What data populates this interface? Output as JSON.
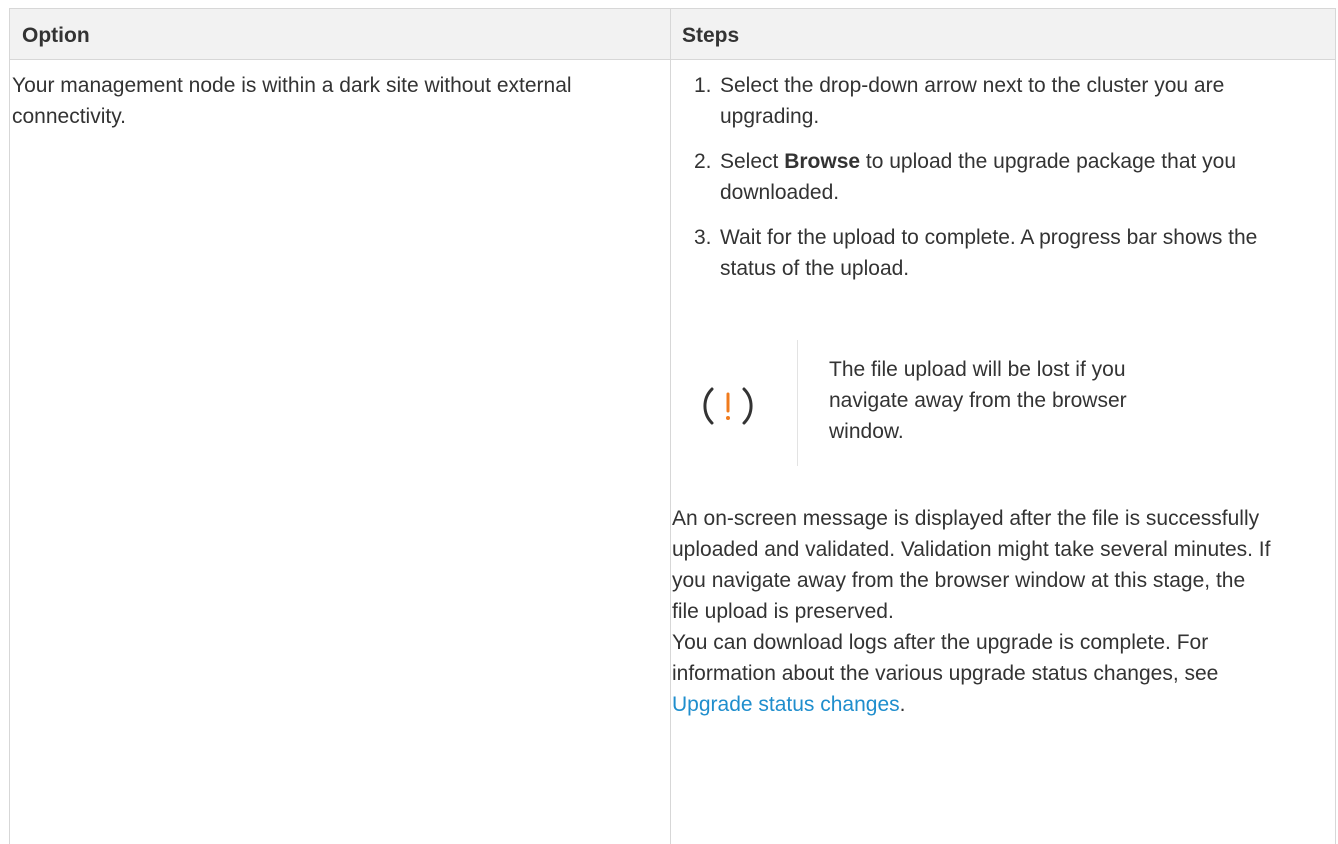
{
  "table": {
    "headers": {
      "option": "Option",
      "steps": "Steps"
    },
    "row": {
      "option": "Your management node is within a dark site without external connectivity.",
      "steps": [
        {
          "num": "1.",
          "text": "Select the drop-down arrow next to the cluster you are upgrading."
        },
        {
          "num": "2.",
          "pre": "Select ",
          "bold": "Browse",
          "post": " to upload the upgrade package that you downloaded."
        },
        {
          "num": "3.",
          "text": "Wait for the upload to complete. A progress bar shows the status of the upload."
        }
      ],
      "caution": {
        "icon": "caution-icon",
        "text": "The file upload will be lost if you navigate away from the browser window."
      },
      "paragraph1": "An on-screen message is displayed after the file is successfully uploaded and validated. Validation might take several minutes. If you navigate away from the browser window at this stage, the file upload is preserved.",
      "paragraph2_pre": "You can download logs after the upgrade is complete. For information about the various upgrade status changes, see ",
      "paragraph2_link": "Upgrade status changes",
      "paragraph2_post": "."
    }
  },
  "colors": {
    "link": "#1f8ecd",
    "caution_icon_ring": "#333333",
    "caution_icon_mark": "#f07b1d",
    "header_bg": "#f2f2f2",
    "border": "#d7d7d7"
  }
}
